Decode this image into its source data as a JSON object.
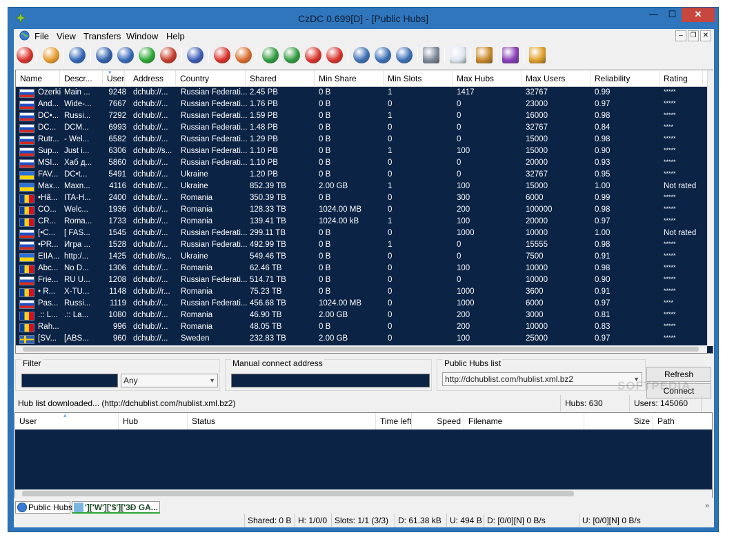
{
  "window": {
    "title": "CzDC 0.699[D] - [Public Hubs]"
  },
  "menu": [
    "File",
    "View",
    "Transfers",
    "Window",
    "Help"
  ],
  "mdi": {
    "min": "–",
    "restore": "❐",
    "close": "✕"
  },
  "caption": {
    "min": "—",
    "max": "☐",
    "close": "✕"
  },
  "toolbar": [
    {
      "icon": "disconnect-icon",
      "color": "#d8322a"
    },
    {
      "icon": "folder-open-icon",
      "color": "#e59a2b"
    },
    {
      "icon": "public-hubs-icon",
      "color": "#2f66b5"
    },
    {
      "icon": "reconnect-icon",
      "color": "#2f5faa"
    },
    {
      "icon": "follow-redirect-icon",
      "color": "#3568b8"
    },
    {
      "icon": "green-ball-icon",
      "color": "#2aa634"
    },
    {
      "icon": "search-spy-icon",
      "color": "#c43a2a"
    },
    {
      "icon": "check-icon",
      "color": "#3a5bb5"
    },
    {
      "icon": "favorites-icon",
      "color": "#d8322a"
    },
    {
      "icon": "favorite-users-icon",
      "color": "#d86a2a"
    },
    {
      "icon": "download-queue-icon",
      "color": "#2f9b3f"
    },
    {
      "icon": "finished-downloads-icon",
      "color": "#2f9b3f"
    },
    {
      "icon": "upload-queue-icon",
      "color": "#d8322a"
    },
    {
      "icon": "finished-uploads-icon",
      "color": "#d8322a"
    },
    {
      "icon": "search-icon",
      "color": "#3b6fb5"
    },
    {
      "icon": "adl-search-icon",
      "color": "#3b6fb5"
    },
    {
      "icon": "search-spy-magnifier-icon",
      "color": "#3b6fb5"
    },
    {
      "icon": "network-stats-icon",
      "color": "#7d8a99"
    },
    {
      "icon": "notepad-icon",
      "color": "#dfe6ef"
    },
    {
      "icon": "open-file-list-icon",
      "color": "#c9892a"
    },
    {
      "icon": "plugins-icon",
      "color": "#8a3fb8"
    },
    {
      "icon": "settings-icon",
      "color": "#e0a02b"
    }
  ],
  "hubs": {
    "columns": [
      "Name",
      "Descr...",
      "Users",
      "Address",
      "Country",
      "Shared",
      "Min Share",
      "Min Slots",
      "Max Hubs",
      "Max Users",
      "Reliability",
      "Rating"
    ],
    "rows": [
      {
        "flag": "ru",
        "name": "Ozerki",
        "desc": "Main ...",
        "users": "9248",
        "address": "dchub://...",
        "country": "Russian Federati...",
        "shared": "2.45 PB",
        "minshare": "0 B",
        "minslots": "1",
        "maxhubs": "1417",
        "maxusers": "32767",
        "rel": "0.99",
        "rating": "*****"
      },
      {
        "flag": "ru",
        "name": "And...",
        "desc": "Wide-...",
        "users": "7667",
        "address": "dchub://...",
        "country": "Russian Federati...",
        "shared": "1.76 PB",
        "minshare": "0 B",
        "minslots": "0",
        "maxhubs": "0",
        "maxusers": "23000",
        "rel": "0.97",
        "rating": "*****"
      },
      {
        "flag": "ru",
        "name": "DC•...",
        "desc": "Russi...",
        "users": "7292",
        "address": "dchub://...",
        "country": "Russian Federati...",
        "shared": "1.59 PB",
        "minshare": "0 B",
        "minslots": "1",
        "maxhubs": "0",
        "maxusers": "16000",
        "rel": "0.98",
        "rating": "*****"
      },
      {
        "flag": "ru",
        "name": "DC...",
        "desc": "DCM...",
        "users": "6993",
        "address": "dchub://...",
        "country": "Russian Federati...",
        "shared": "1.48 PB",
        "minshare": "0 B",
        "minslots": "0",
        "maxhubs": "0",
        "maxusers": "32767",
        "rel": "0.84",
        "rating": "****"
      },
      {
        "flag": "ru",
        "name": "Rutr...",
        "desc": "- Wel...",
        "users": "6582",
        "address": "dchub://...",
        "country": "Russian Federati...",
        "shared": "1.29 PB",
        "minshare": "0 B",
        "minslots": "0",
        "maxhubs": "0",
        "maxusers": "15000",
        "rel": "0.98",
        "rating": "*****"
      },
      {
        "flag": "ru",
        "name": "Sup...",
        "desc": "Just i...",
        "users": "6306",
        "address": "dchub://s...",
        "country": "Russian Federati...",
        "shared": "1.10 PB",
        "minshare": "0 B",
        "minslots": "1",
        "maxhubs": "100",
        "maxusers": "15000",
        "rel": "0.90",
        "rating": "*****"
      },
      {
        "flag": "ru",
        "name": "MSI...",
        "desc": "Хаб д...",
        "users": "5860",
        "address": "dchub://...",
        "country": "Russian Federati...",
        "shared": "1.10 PB",
        "minshare": "0 B",
        "minslots": "0",
        "maxhubs": "0",
        "maxusers": "20000",
        "rel": "0.93",
        "rating": "*****"
      },
      {
        "flag": "ua",
        "name": "FAV...",
        "desc": "DC•t...",
        "users": "5491",
        "address": "dchub://...",
        "country": "Ukraine",
        "shared": "1.20 PB",
        "minshare": "0 B",
        "minslots": "0",
        "maxhubs": "0",
        "maxusers": "32767",
        "rel": "0.95",
        "rating": "*****"
      },
      {
        "flag": "ua",
        "name": "Max...",
        "desc": "Maxn...",
        "users": "4116",
        "address": "dchub://...",
        "country": "Ukraine",
        "shared": "852.39 TB",
        "minshare": "2.00 GB",
        "minslots": "1",
        "maxhubs": "100",
        "maxusers": "15000",
        "rel": "1.00",
        "rating": "Not rated"
      },
      {
        "flag": "ro",
        "name": "•Hã...",
        "desc": "ITA-H...",
        "users": "2400",
        "address": "dchub://...",
        "country": "Romania",
        "shared": "350.39 TB",
        "minshare": "0 B",
        "minslots": "0",
        "maxhubs": "300",
        "maxusers": "6000",
        "rel": "0.99",
        "rating": "*****"
      },
      {
        "flag": "ro",
        "name": "CO...",
        "desc": "Welc...",
        "users": "1936",
        "address": "dchub://...",
        "country": "Romania",
        "shared": "128.33 TB",
        "minshare": "1024.00 MB",
        "minslots": "0",
        "maxhubs": "200",
        "maxusers": "100000",
        "rel": "0.98",
        "rating": "*****"
      },
      {
        "flag": "ro",
        "name": "CR...",
        "desc": "Roma...",
        "users": "1733",
        "address": "dchub://...",
        "country": "Romania",
        "shared": "139.41 TB",
        "minshare": "1024.00 kB",
        "minslots": "1",
        "maxhubs": "100",
        "maxusers": "20000",
        "rel": "0.97",
        "rating": "*****"
      },
      {
        "flag": "ru",
        "name": "[•C...",
        "desc": "[ FAS...",
        "users": "1545",
        "address": "dchub://...",
        "country": "Russian Federati...",
        "shared": "299.11 TB",
        "minshare": "0 B",
        "minslots": "0",
        "maxhubs": "1000",
        "maxusers": "10000",
        "rel": "1.00",
        "rating": "Not rated"
      },
      {
        "flag": "ru",
        "name": "•PR...",
        "desc": "Игра ...",
        "users": "1528",
        "address": "dchub://...",
        "country": "Russian Federati...",
        "shared": "492.99 TB",
        "minshare": "0 B",
        "minslots": "1",
        "maxhubs": "0",
        "maxusers": "15555",
        "rel": "0.98",
        "rating": "*****"
      },
      {
        "flag": "ua",
        "name": "ÈÏIÄ...",
        "desc": "http:/...",
        "users": "1425",
        "address": "dchub://s...",
        "country": "Ukraine",
        "shared": "549.46 TB",
        "minshare": "0 B",
        "minslots": "0",
        "maxhubs": "0",
        "maxusers": "7500",
        "rel": "0.91",
        "rating": "*****"
      },
      {
        "flag": "ro",
        "name": "Abc...",
        "desc": "No D...",
        "users": "1306",
        "address": "dchub://...",
        "country": "Romania",
        "shared": "62.46 TB",
        "minshare": "0 B",
        "minslots": "0",
        "maxhubs": "100",
        "maxusers": "10000",
        "rel": "0.98",
        "rating": "*****"
      },
      {
        "flag": "ru",
        "name": "Frie...",
        "desc": "RU U...",
        "users": "1208",
        "address": "dchub://...",
        "country": "Russian Federati...",
        "shared": "514.71 TB",
        "minshare": "0 B",
        "minslots": "0",
        "maxhubs": "0",
        "maxusers": "10000",
        "rel": "0.90",
        "rating": "*****"
      },
      {
        "flag": "ro",
        "name": "• R...",
        "desc": "X-TU...",
        "users": "1148",
        "address": "dchub://r...",
        "country": "Romania",
        "shared": "75.23 TB",
        "minshare": "0 B",
        "minslots": "0",
        "maxhubs": "1000",
        "maxusers": "3600",
        "rel": "0.91",
        "rating": "*****"
      },
      {
        "flag": "ru",
        "name": "Pas...",
        "desc": "Russi...",
        "users": "1119",
        "address": "dchub://...",
        "country": "Russian Federati...",
        "shared": "456.68 TB",
        "minshare": "1024.00 MB",
        "minslots": "0",
        "maxhubs": "1000",
        "maxusers": "6000",
        "rel": "0.97",
        "rating": "****"
      },
      {
        "flag": "ro",
        "name": ".:: L...",
        "desc": ".:: La...",
        "users": "1080",
        "address": "dchub://...",
        "country": "Romania",
        "shared": "46.90 TB",
        "minshare": "2.00 GB",
        "minslots": "0",
        "maxhubs": "200",
        "maxusers": "3000",
        "rel": "0.81",
        "rating": "*****"
      },
      {
        "flag": "ro",
        "name": "Rah...",
        "desc": "",
        "users": "996",
        "address": "dchub://...",
        "country": "Romania",
        "shared": "48.05 TB",
        "minshare": "0 B",
        "minslots": "0",
        "maxhubs": "200",
        "maxusers": "10000",
        "rel": "0.83",
        "rating": "*****"
      },
      {
        "flag": "se",
        "name": "[SV...",
        "desc": "[ABS...",
        "users": "960",
        "address": "dchub://...",
        "country": "Sweden",
        "shared": "232.83 TB",
        "minshare": "2.00 GB",
        "minslots": "0",
        "maxhubs": "100",
        "maxusers": "25000",
        "rel": "0.97",
        "rating": "*****"
      }
    ]
  },
  "panel": {
    "filter_label": "Filter",
    "filter_value": "",
    "filter_select": "Any",
    "manual_label": "Manual connect address",
    "manual_value": "",
    "list_label": "Public Hubs list",
    "list_select": "http://dchublist.com/hublist.xml.bz2",
    "refresh": "Refresh",
    "connect": "Connect"
  },
  "status": {
    "message": "Hub list downloaded... (http://dchublist.com/hublist.xml.bz2)",
    "hubs": "Hubs: 630",
    "users": "Users: 145060"
  },
  "transfers": {
    "columns": [
      "User",
      "Hub",
      "Status",
      "Time left",
      "Speed",
      "Filename",
      "Size",
      "Path"
    ]
  },
  "tabs": [
    {
      "label": "Public Hubs",
      "icon": "globe-icon",
      "active": true
    },
    {
      "label": "']['W']['$']['3Ð GA...",
      "icon": "hub-icon",
      "active": false
    }
  ],
  "bottom_status": {
    "shared": "Shared: 0 B",
    "hubs": "H: 1/0/0",
    "slots": "Slots: 1/1 (3/3)",
    "download": "D: 61.38 kB",
    "upload": "U: 494 B",
    "down_rate": "D: [0/0][N] 0 B/s",
    "up_rate": "U: [0/0][N] 0 B/s"
  },
  "watermark": "SOFTPEDIA",
  "colors": {
    "grid_bg": "#0b2345",
    "title_bg": "#2f76bd",
    "ru": [
      "#ffffff",
      "#1e4fc4",
      "#d52b1e"
    ],
    "ua": [
      "#2f6fd8",
      "#ffd500"
    ],
    "ro": [
      "#0a3fa0",
      "#fcd116",
      "#ce1126"
    ],
    "se": [
      "#2a62b8",
      "#fecb00"
    ]
  }
}
